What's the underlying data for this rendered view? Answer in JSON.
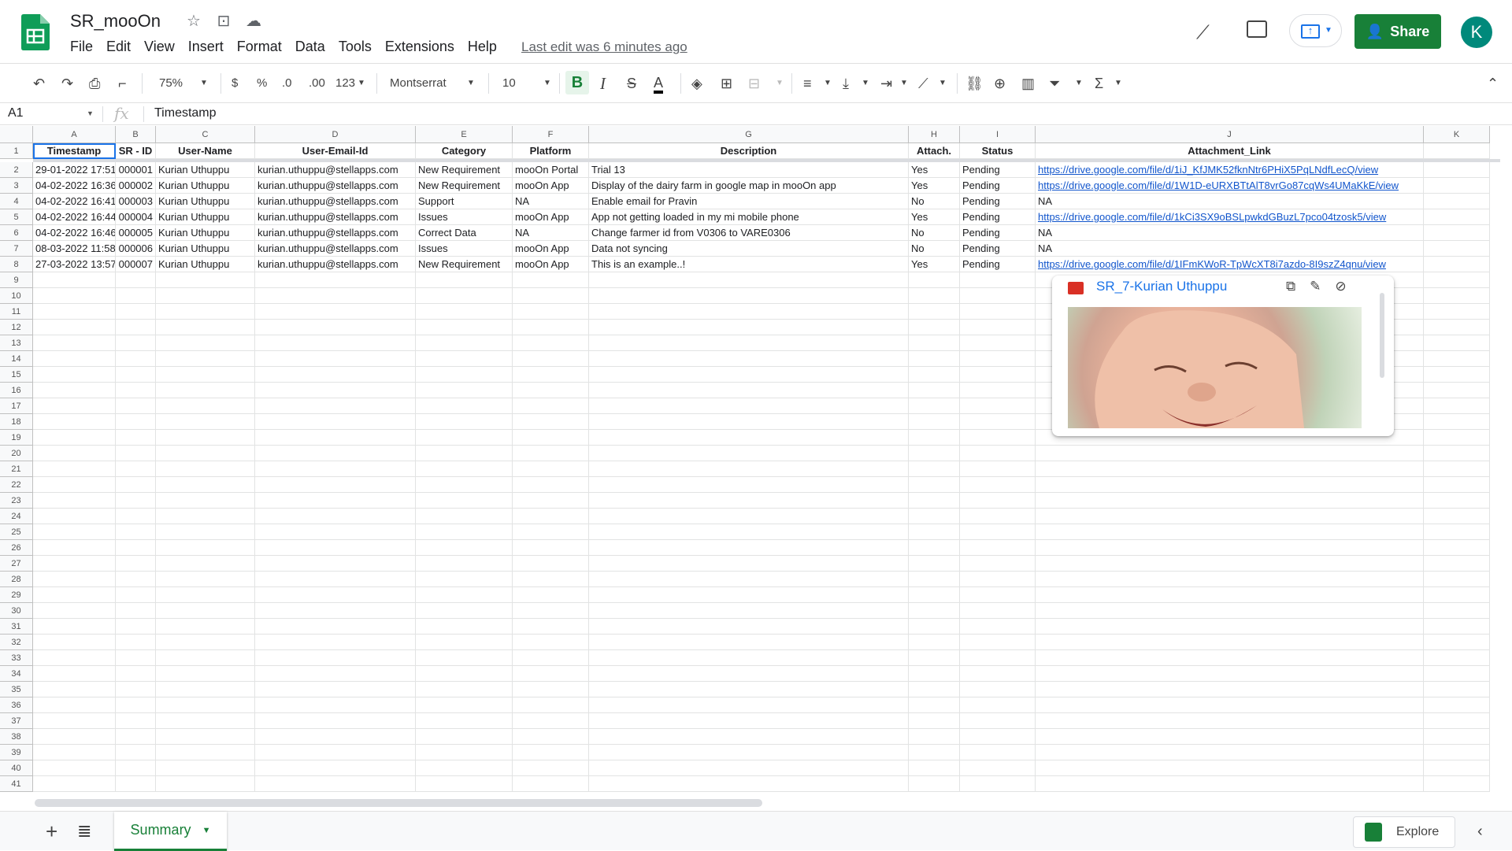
{
  "app": {
    "doc_title": "SR_mooOn",
    "menu": [
      "File",
      "Edit",
      "View",
      "Insert",
      "Format",
      "Data",
      "Tools",
      "Extensions",
      "Help"
    ],
    "last_edit": "Last edit was 6 minutes ago",
    "share_label": "Share",
    "avatar_initial": "K"
  },
  "toolbar": {
    "zoom": "75%",
    "currency": "$",
    "percent": "%",
    "dec_decrease": ".0",
    "dec_increase": ".00",
    "format_more": "123",
    "font": "Montserrat",
    "font_size": "10",
    "bold": "B",
    "italic": "I",
    "strike": "S",
    "text_color": "A"
  },
  "formula_bar": {
    "name_box": "A1",
    "fx": "fx",
    "value": "Timestamp"
  },
  "columns": [
    "A",
    "B",
    "C",
    "D",
    "E",
    "F",
    "G",
    "H",
    "I",
    "J",
    "K"
  ],
  "row_numbers": [
    "1",
    "2",
    "3",
    "4",
    "5",
    "6",
    "7",
    "8",
    "9",
    "10",
    "11",
    "12",
    "13",
    "14",
    "15",
    "16",
    "17",
    "18",
    "19",
    "20",
    "21",
    "22",
    "23",
    "24",
    "25",
    "26",
    "27",
    "28",
    "29",
    "30",
    "31",
    "32",
    "33",
    "34",
    "35",
    "36",
    "37",
    "38",
    "39",
    "40",
    "41"
  ],
  "headers": [
    "Timestamp",
    "SR - ID",
    "User-Name",
    "User-Email-Id",
    "Category",
    "Platform",
    "Description",
    "Attach.",
    "Status",
    "Attachment_Link"
  ],
  "rows": [
    [
      "29-01-2022 17:51",
      "000001",
      "Kurian Uthuppu",
      "kurian.uthuppu@stellapps.com",
      "New Requirement",
      "mooOn Portal",
      "Trial 13",
      "Yes",
      "Pending",
      "https://drive.google.com/file/d/1iJ_KfJMK52fknNtr6PHiX5PqLNdfLecQ/view"
    ],
    [
      "04-02-2022 16:36",
      "000002",
      "Kurian Uthuppu",
      "kurian.uthuppu@stellapps.com",
      "New Requirement",
      "mooOn App",
      "Display of the dairy farm in google map in mooOn app",
      "Yes",
      "Pending",
      "https://drive.google.com/file/d/1W1D-eURXBTtAlT8vrGo87cqWs4UMaKkE/view"
    ],
    [
      "04-02-2022 16:41",
      "000003",
      "Kurian Uthuppu",
      "kurian.uthuppu@stellapps.com",
      "Support",
      "NA",
      "Enable email for Pravin",
      "No",
      "Pending",
      "NA"
    ],
    [
      "04-02-2022 16:44",
      "000004",
      "Kurian Uthuppu",
      "kurian.uthuppu@stellapps.com",
      "Issues",
      "mooOn App",
      "App not getting loaded in my mi mobile phone",
      "Yes",
      "Pending",
      "https://drive.google.com/file/d/1kCi3SX9oBSLpwkdGBuzL7pco04tzosk5/view"
    ],
    [
      "04-02-2022 16:46",
      "000005",
      "Kurian Uthuppu",
      "kurian.uthuppu@stellapps.com",
      "Correct Data",
      "NA",
      "Change farmer id from V0306 to VARE0306",
      "No",
      "Pending",
      "NA"
    ],
    [
      "08-03-2022 11:58",
      "000006",
      "Kurian Uthuppu",
      "kurian.uthuppu@stellapps.com",
      "Issues",
      "mooOn App",
      "Data not syncing",
      "No",
      "Pending",
      "NA"
    ],
    [
      "27-03-2022 13:57",
      "000007",
      "Kurian Uthuppu",
      "kurian.uthuppu@stellapps.com",
      "New Requirement",
      "mooOn App",
      "This is an example..!",
      "Yes",
      "Pending",
      "https://drive.google.com/file/d/1IFmKWoR-TpWcXT8i7azdo-8I9szZ4qnu/view"
    ]
  ],
  "popup": {
    "title": "SR_7-Kurian Uthuppu"
  },
  "bottom": {
    "sheet_tab": "Summary",
    "explore": "Explore"
  },
  "colors": {
    "accent": "#188038",
    "link": "#1155cc",
    "select": "#1a73e8"
  }
}
